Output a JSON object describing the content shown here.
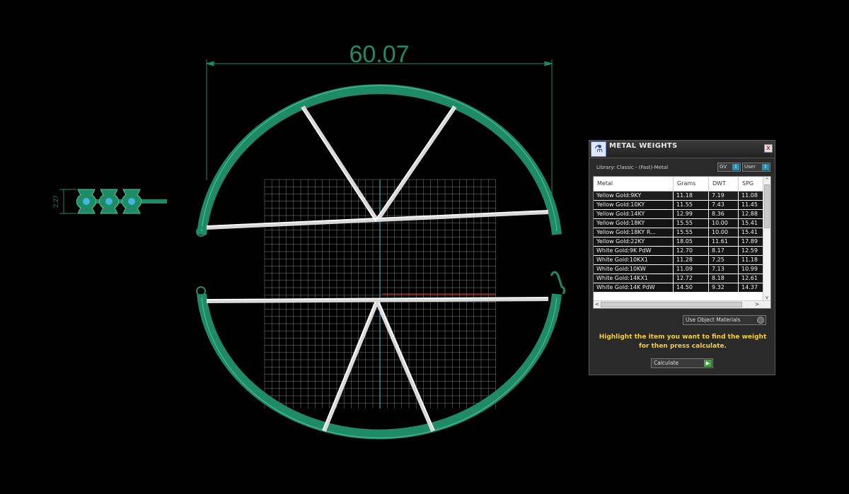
{
  "viewport": {
    "dimension_main": "60.07",
    "dimension_side": "2.27",
    "colors": {
      "ring": "#1f8a66",
      "grid": "#e6e6e6",
      "bars": "#d9d9d9",
      "axis": "#3fd0e0",
      "background": "#000000"
    }
  },
  "panel": {
    "app_icon": "flask-icon",
    "title": "METAL WEIGHTS",
    "close_label": "x",
    "library_label": "Library: Classic - (Fast)-Metal",
    "gv_label": "GV",
    "user_label": "User",
    "toggle_glyph": "I",
    "columns": [
      "Metal",
      "Grams",
      "DWT",
      "SPG"
    ],
    "rows": [
      {
        "metal": "Yellow Gold:9KY",
        "grams": "11.18",
        "dwt": "7.19",
        "spg": "11.08"
      },
      {
        "metal": "Yellow Gold:10KY",
        "grams": "11.55",
        "dwt": "7.43",
        "spg": "11.45"
      },
      {
        "metal": "Yellow Gold:14KY",
        "grams": "12.99",
        "dwt": "8.36",
        "spg": "12.88"
      },
      {
        "metal": "Yellow Gold:18KY",
        "grams": "15.55",
        "dwt": "10.00",
        "spg": "15.41"
      },
      {
        "metal": "Yellow Gold:18KY R...",
        "grams": "15.55",
        "dwt": "10.00",
        "spg": "15.41"
      },
      {
        "metal": "Yellow Gold:22KY",
        "grams": "18.05",
        "dwt": "11.61",
        "spg": "17.89"
      },
      {
        "metal": "White Gold:9K PdW",
        "grams": "12.70",
        "dwt": "8.17",
        "spg": "12.59"
      },
      {
        "metal": "White Gold:10KX1",
        "grams": "11.28",
        "dwt": "7.25",
        "spg": "11.18"
      },
      {
        "metal": "White Gold:10KW",
        "grams": "11.09",
        "dwt": "7.13",
        "spg": "10.99"
      },
      {
        "metal": "White Gold:14KX1",
        "grams": "12.72",
        "dwt": "8.18",
        "spg": "12.61"
      },
      {
        "metal": "White Gold:14K PdW",
        "grams": "14.50",
        "dwt": "9.32",
        "spg": "14.37"
      }
    ],
    "scroll_up": "^",
    "scroll_down": "v",
    "scroll_left": "<",
    "scroll_right": ">",
    "use_object_materials": "Use Object Materials",
    "hint": "Highlight the item you want to find the weight for then press calculate.",
    "calculate_label": "Calculate",
    "calculate_go": "▶"
  }
}
